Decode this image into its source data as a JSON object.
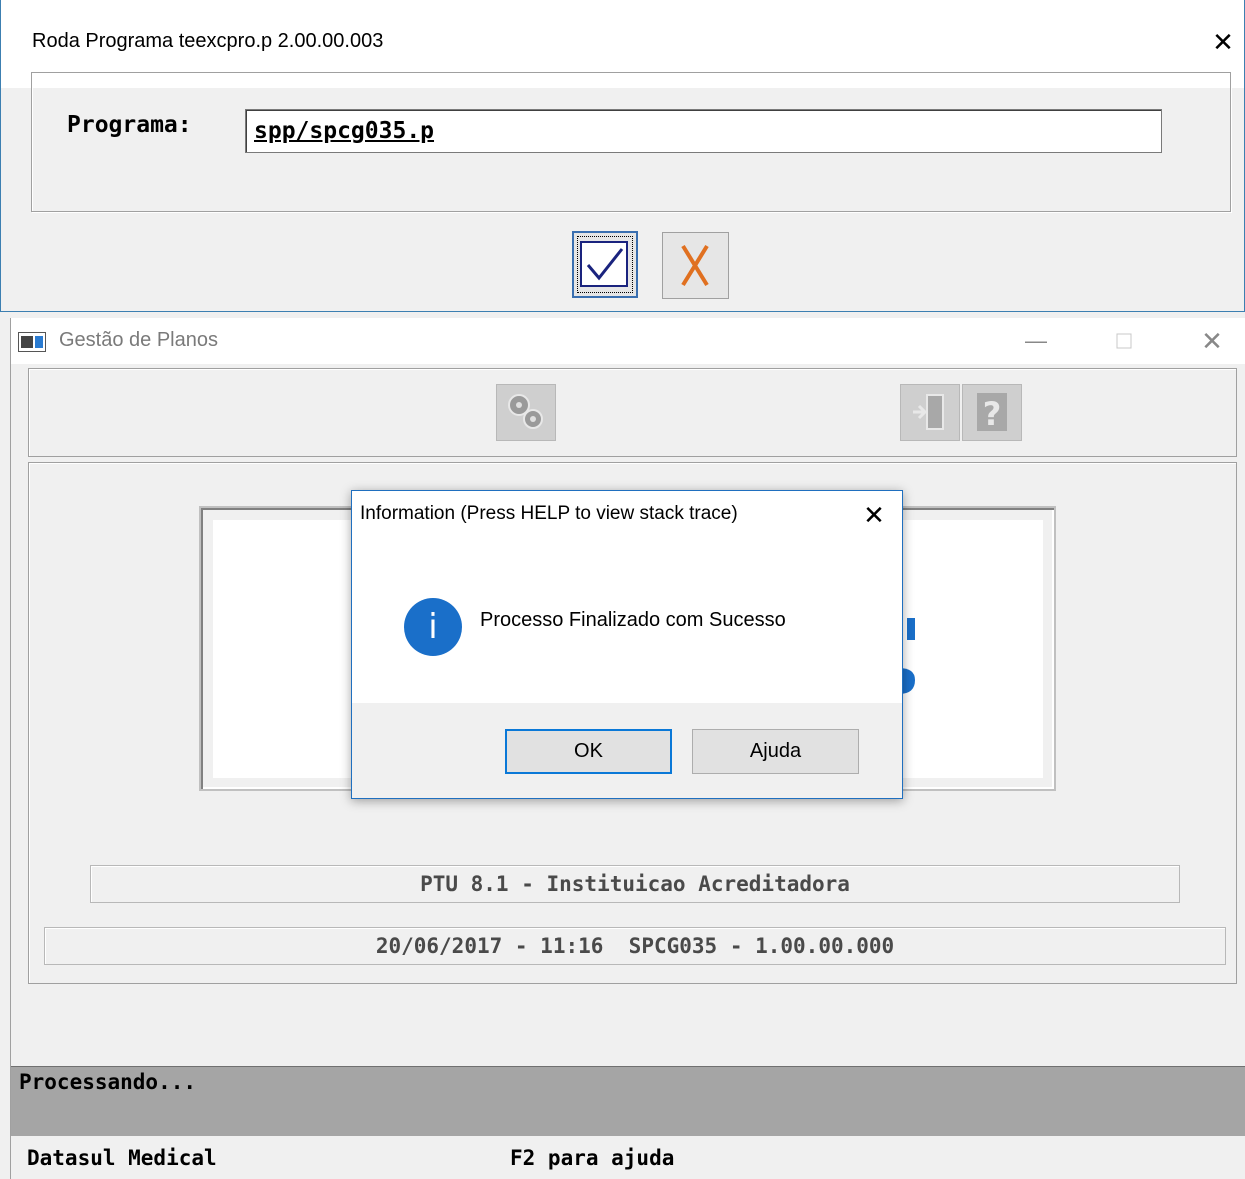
{
  "run_window": {
    "title": "Roda Programa teexcpro.p  2.00.00.003",
    "program_label": "Programa:",
    "program_value": "spp/spcg035.p"
  },
  "main_window": {
    "title": "Gestão de Planos",
    "ptu_text": "PTU 8.1 - Instituicao Acreditadora",
    "date_version_text": "20/06/2017 - 11:16  SPCG035 - 1.00.00.000",
    "status_text": "Processando...",
    "footer_left": "Datasul Medical",
    "footer_right": "F2 para ajuda"
  },
  "dialog": {
    "title": "Information (Press HELP to view stack trace)",
    "message": "Processo Finalizado com Sucesso",
    "ok_label": "OK",
    "help_label": "Ajuda"
  },
  "colors": {
    "accent": "#1a6fc9",
    "focus_border": "#0a78d7",
    "status_bar": "#a5a5a5"
  }
}
